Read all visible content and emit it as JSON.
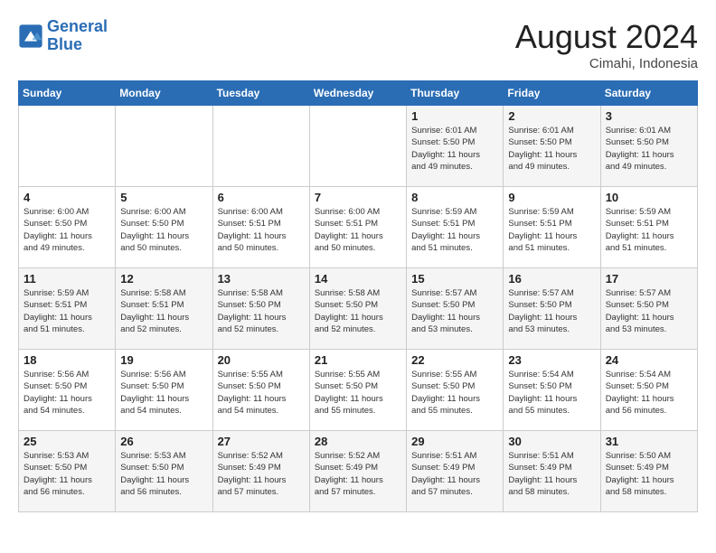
{
  "logo": {
    "line1": "General",
    "line2": "Blue"
  },
  "title": "August 2024",
  "location": "Cimahi, Indonesia",
  "weekdays": [
    "Sunday",
    "Monday",
    "Tuesday",
    "Wednesday",
    "Thursday",
    "Friday",
    "Saturday"
  ],
  "weeks": [
    [
      {
        "day": "",
        "info": ""
      },
      {
        "day": "",
        "info": ""
      },
      {
        "day": "",
        "info": ""
      },
      {
        "day": "",
        "info": ""
      },
      {
        "day": "1",
        "info": "Sunrise: 6:01 AM\nSunset: 5:50 PM\nDaylight: 11 hours\nand 49 minutes."
      },
      {
        "day": "2",
        "info": "Sunrise: 6:01 AM\nSunset: 5:50 PM\nDaylight: 11 hours\nand 49 minutes."
      },
      {
        "day": "3",
        "info": "Sunrise: 6:01 AM\nSunset: 5:50 PM\nDaylight: 11 hours\nand 49 minutes."
      }
    ],
    [
      {
        "day": "4",
        "info": "Sunrise: 6:00 AM\nSunset: 5:50 PM\nDaylight: 11 hours\nand 49 minutes."
      },
      {
        "day": "5",
        "info": "Sunrise: 6:00 AM\nSunset: 5:50 PM\nDaylight: 11 hours\nand 50 minutes."
      },
      {
        "day": "6",
        "info": "Sunrise: 6:00 AM\nSunset: 5:51 PM\nDaylight: 11 hours\nand 50 minutes."
      },
      {
        "day": "7",
        "info": "Sunrise: 6:00 AM\nSunset: 5:51 PM\nDaylight: 11 hours\nand 50 minutes."
      },
      {
        "day": "8",
        "info": "Sunrise: 5:59 AM\nSunset: 5:51 PM\nDaylight: 11 hours\nand 51 minutes."
      },
      {
        "day": "9",
        "info": "Sunrise: 5:59 AM\nSunset: 5:51 PM\nDaylight: 11 hours\nand 51 minutes."
      },
      {
        "day": "10",
        "info": "Sunrise: 5:59 AM\nSunset: 5:51 PM\nDaylight: 11 hours\nand 51 minutes."
      }
    ],
    [
      {
        "day": "11",
        "info": "Sunrise: 5:59 AM\nSunset: 5:51 PM\nDaylight: 11 hours\nand 51 minutes."
      },
      {
        "day": "12",
        "info": "Sunrise: 5:58 AM\nSunset: 5:51 PM\nDaylight: 11 hours\nand 52 minutes."
      },
      {
        "day": "13",
        "info": "Sunrise: 5:58 AM\nSunset: 5:50 PM\nDaylight: 11 hours\nand 52 minutes."
      },
      {
        "day": "14",
        "info": "Sunrise: 5:58 AM\nSunset: 5:50 PM\nDaylight: 11 hours\nand 52 minutes."
      },
      {
        "day": "15",
        "info": "Sunrise: 5:57 AM\nSunset: 5:50 PM\nDaylight: 11 hours\nand 53 minutes."
      },
      {
        "day": "16",
        "info": "Sunrise: 5:57 AM\nSunset: 5:50 PM\nDaylight: 11 hours\nand 53 minutes."
      },
      {
        "day": "17",
        "info": "Sunrise: 5:57 AM\nSunset: 5:50 PM\nDaylight: 11 hours\nand 53 minutes."
      }
    ],
    [
      {
        "day": "18",
        "info": "Sunrise: 5:56 AM\nSunset: 5:50 PM\nDaylight: 11 hours\nand 54 minutes."
      },
      {
        "day": "19",
        "info": "Sunrise: 5:56 AM\nSunset: 5:50 PM\nDaylight: 11 hours\nand 54 minutes."
      },
      {
        "day": "20",
        "info": "Sunrise: 5:55 AM\nSunset: 5:50 PM\nDaylight: 11 hours\nand 54 minutes."
      },
      {
        "day": "21",
        "info": "Sunrise: 5:55 AM\nSunset: 5:50 PM\nDaylight: 11 hours\nand 55 minutes."
      },
      {
        "day": "22",
        "info": "Sunrise: 5:55 AM\nSunset: 5:50 PM\nDaylight: 11 hours\nand 55 minutes."
      },
      {
        "day": "23",
        "info": "Sunrise: 5:54 AM\nSunset: 5:50 PM\nDaylight: 11 hours\nand 55 minutes."
      },
      {
        "day": "24",
        "info": "Sunrise: 5:54 AM\nSunset: 5:50 PM\nDaylight: 11 hours\nand 56 minutes."
      }
    ],
    [
      {
        "day": "25",
        "info": "Sunrise: 5:53 AM\nSunset: 5:50 PM\nDaylight: 11 hours\nand 56 minutes."
      },
      {
        "day": "26",
        "info": "Sunrise: 5:53 AM\nSunset: 5:50 PM\nDaylight: 11 hours\nand 56 minutes."
      },
      {
        "day": "27",
        "info": "Sunrise: 5:52 AM\nSunset: 5:49 PM\nDaylight: 11 hours\nand 57 minutes."
      },
      {
        "day": "28",
        "info": "Sunrise: 5:52 AM\nSunset: 5:49 PM\nDaylight: 11 hours\nand 57 minutes."
      },
      {
        "day": "29",
        "info": "Sunrise: 5:51 AM\nSunset: 5:49 PM\nDaylight: 11 hours\nand 57 minutes."
      },
      {
        "day": "30",
        "info": "Sunrise: 5:51 AM\nSunset: 5:49 PM\nDaylight: 11 hours\nand 58 minutes."
      },
      {
        "day": "31",
        "info": "Sunrise: 5:50 AM\nSunset: 5:49 PM\nDaylight: 11 hours\nand 58 minutes."
      }
    ]
  ]
}
